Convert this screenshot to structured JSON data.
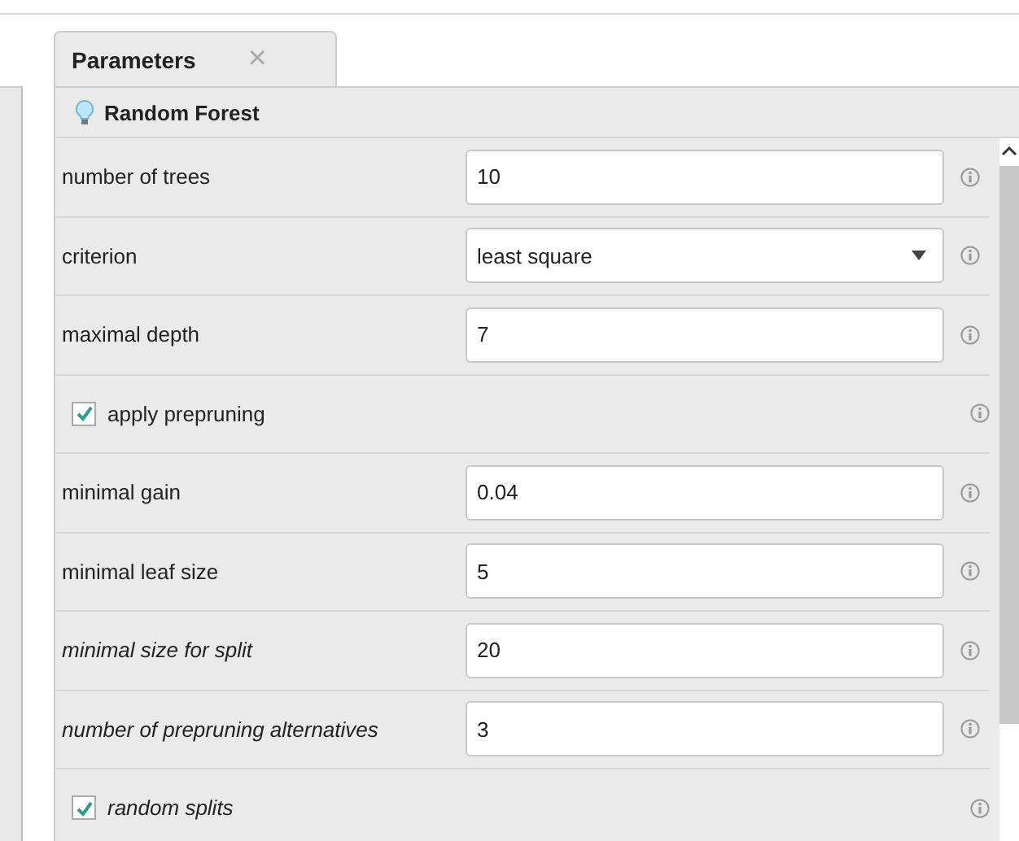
{
  "tab": {
    "label": "Parameters",
    "close": "×",
    "selected": true
  },
  "operator": {
    "name": "Random Forest"
  },
  "parameters": [
    {
      "kind": "number",
      "label": "number of trees",
      "value": "10",
      "italic": false
    },
    {
      "kind": "select",
      "label": "criterion",
      "value": "least square",
      "italic": false
    },
    {
      "kind": "number",
      "label": "maximal depth",
      "value": "7",
      "italic": false
    },
    {
      "kind": "checkbox",
      "label": "apply prepruning",
      "checked": true,
      "italic": false
    },
    {
      "kind": "number",
      "label": "minimal gain",
      "value": "0.04",
      "italic": false
    },
    {
      "kind": "number",
      "label": "minimal leaf size",
      "value": "5",
      "italic": false
    },
    {
      "kind": "number",
      "label": "minimal size for split",
      "value": "20",
      "italic": true
    },
    {
      "kind": "number",
      "label": "number of prepruning alternatives",
      "value": "3",
      "italic": true
    },
    {
      "kind": "checkbox",
      "label": "random splits",
      "checked": true,
      "italic": true
    }
  ]
}
